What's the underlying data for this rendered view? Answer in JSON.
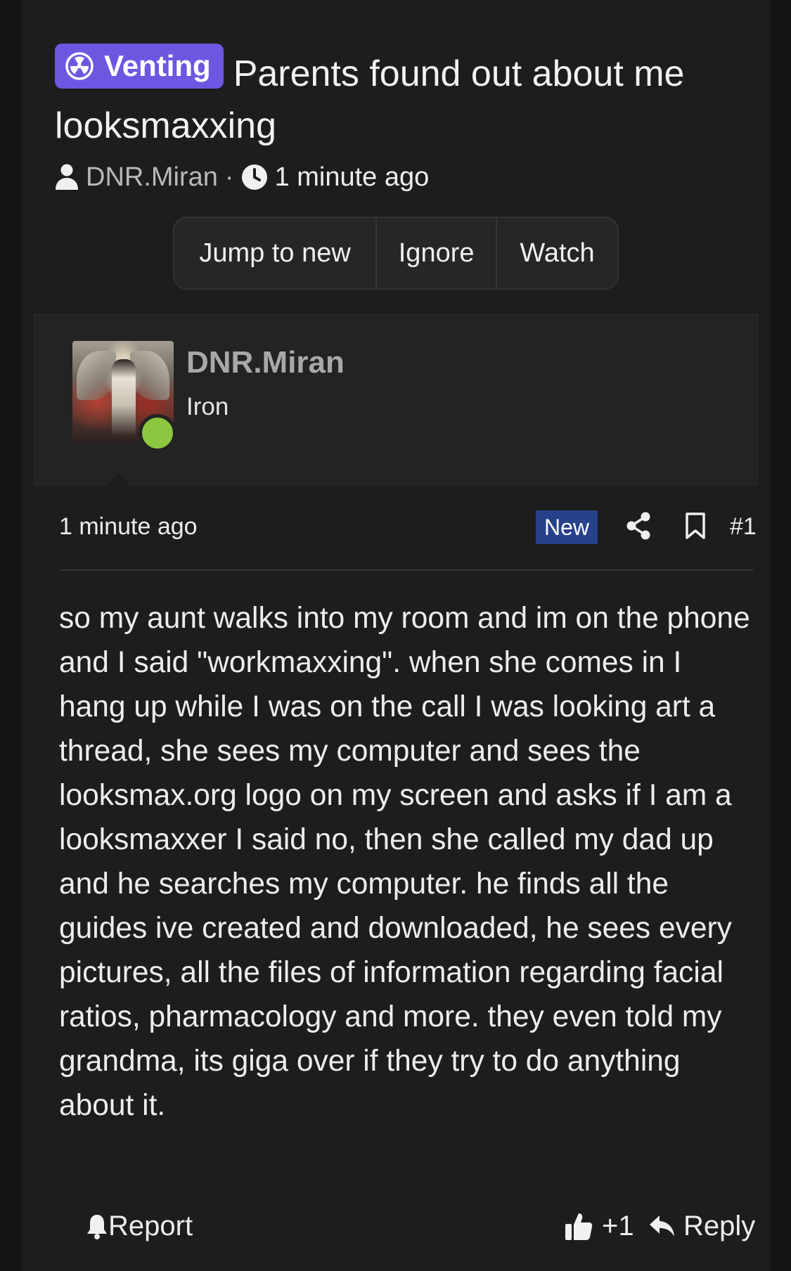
{
  "thread": {
    "prefix": "Venting",
    "title": "Parents found out about me looksmaxxing",
    "author": "DNR.Miran",
    "separator": "·",
    "time": "1 minute ago",
    "prefix_icon": "radiation-icon",
    "prefix_color": "#6c58e0"
  },
  "actions": {
    "jump": "Jump to new",
    "ignore": "Ignore",
    "watch": "Watch"
  },
  "post": {
    "username": "DNR.Miran",
    "user_title": "Iron",
    "online_status_color": "#8dc63f",
    "time": "1 minute ago",
    "new_badge": "New",
    "number": "#1",
    "body": "so my aunt walks into my room and im on the phone and I said \"workmaxxing\". when she comes in I hang up while I was on the call I was looking art a thread, she sees my computer and sees the looksmax.org logo on my screen and asks if I am a looksmaxxer I said no, then she called my dad up and he searches my computer. he finds all the guides ive created and downloaded, he sees every pictures, all the files of information regarding facial ratios, pharmacology and more. they even told my grandma, its giga over if they try to do anything about it."
  },
  "footer": {
    "report": "Report",
    "like": "+1",
    "reply": "Reply"
  }
}
